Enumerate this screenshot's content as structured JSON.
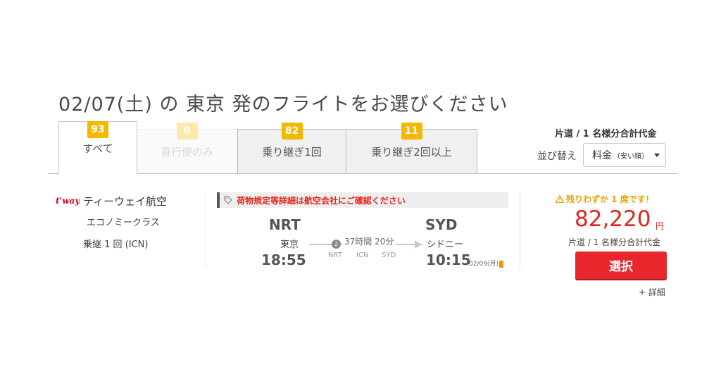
{
  "page_title": "02/07(土) の 東京 発のフライトをお選びください",
  "tabs": [
    {
      "label": "すべて",
      "count": "93",
      "state": "active"
    },
    {
      "label": "直行便のみ",
      "count": "0",
      "state": "disabled"
    },
    {
      "label": "乗り継ぎ1回",
      "count": "82",
      "state": "normal"
    },
    {
      "label": "乗り継ぎ2回以上",
      "count": "11",
      "state": "normal"
    }
  ],
  "sort": {
    "fare_note": "片道 / 1 名様分合計代金",
    "label": "並び替え",
    "selected_main": "料金",
    "selected_sub": "（安い順）"
  },
  "flight": {
    "airline_logo": "t'way",
    "airline_name": "ティーウェイ航空",
    "cabin": "エコノミークラス",
    "stops": "乗継 1 回 (ICN)",
    "notice": "荷物規定等詳細は航空会社にご確認ください",
    "departure": {
      "code": "NRT",
      "city": "東京",
      "time": "18:55"
    },
    "arrival": {
      "code": "SYD",
      "city": "シドニー",
      "time": "10:15",
      "date": "02/09(月)"
    },
    "stop_count": "2",
    "duration": "37時間 20分",
    "via": [
      "NRT",
      "ICN",
      "SYD"
    ]
  },
  "price": {
    "seats_left": "残りわずか 1 席です！",
    "amount": "82,220",
    "currency": "円",
    "fare_note": "片道 / 1 名様分合計代金",
    "select_label": "選択",
    "details_label": "+ 詳細"
  },
  "colors": {
    "accent_red": "#e1251b",
    "badge_yellow": "#f5b800",
    "warning": "#e8a200"
  }
}
